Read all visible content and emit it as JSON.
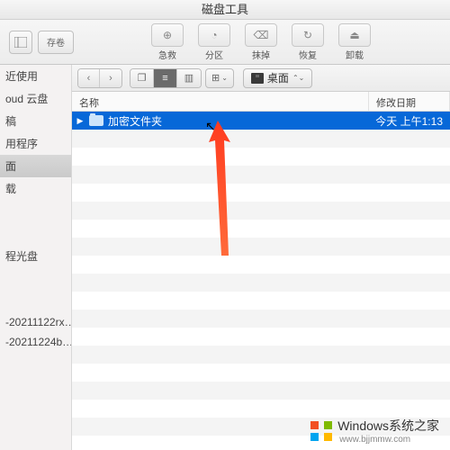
{
  "window": {
    "title": "磁盘工具"
  },
  "toolbar": {
    "left": [
      {
        "name": "show-sidebar-button"
      },
      {
        "name": "add-volume-button",
        "label": "存卷"
      }
    ],
    "center": [
      {
        "name": "first-aid-button",
        "label": "急救"
      },
      {
        "name": "partition-button",
        "label": "分区"
      },
      {
        "name": "erase-button",
        "label": "抹掉"
      },
      {
        "name": "restore-button",
        "label": "恢复"
      },
      {
        "name": "unmount-button",
        "label": "卸载"
      }
    ]
  },
  "sidebar": {
    "items": [
      {
        "label": "近使用",
        "name": "sidebar-recents"
      },
      {
        "label": "oud 云盘",
        "name": "sidebar-icloud"
      },
      {
        "label": "稿",
        "name": "sidebar-drafts"
      },
      {
        "label": "用程序",
        "name": "sidebar-applications"
      },
      {
        "label": "面",
        "name": "sidebar-desktop",
        "selected": true
      },
      {
        "label": "载",
        "name": "sidebar-downloads"
      }
    ],
    "section2": [
      {
        "label": "程光盘",
        "name": "sidebar-remote-disc"
      }
    ],
    "section3": [
      {
        "label": "-20211122rx…",
        "name": "sidebar-tag-1"
      },
      {
        "label": "-20211224b…",
        "name": "sidebar-tag-2"
      }
    ]
  },
  "pathbar": {
    "location": "桌面",
    "group_label": ""
  },
  "columns": {
    "name": "名称",
    "date": "修改日期"
  },
  "files": [
    {
      "name": "加密文件夹",
      "date": "今天 上午1:13",
      "selected": true
    }
  ],
  "watermark": {
    "main": "Windows",
    "sub": "系统之家",
    "url": "www.bjjmmw.com"
  }
}
